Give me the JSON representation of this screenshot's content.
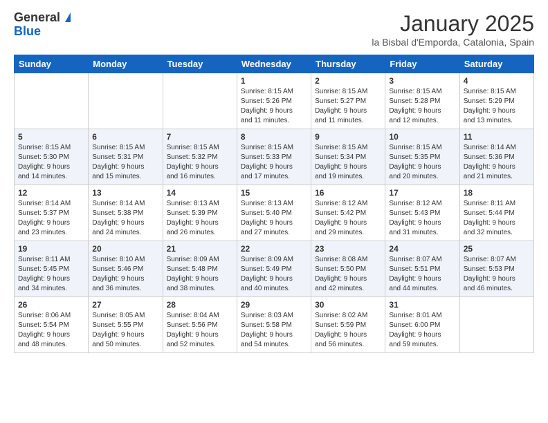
{
  "header": {
    "logo_general": "General",
    "logo_blue": "Blue",
    "month_title": "January 2025",
    "location": "la Bisbal d'Emporda, Catalonia, Spain"
  },
  "weekdays": [
    "Sunday",
    "Monday",
    "Tuesday",
    "Wednesday",
    "Thursday",
    "Friday",
    "Saturday"
  ],
  "weeks": [
    [
      {
        "day": "",
        "info": ""
      },
      {
        "day": "",
        "info": ""
      },
      {
        "day": "",
        "info": ""
      },
      {
        "day": "1",
        "info": "Sunrise: 8:15 AM\nSunset: 5:26 PM\nDaylight: 9 hours\nand 11 minutes."
      },
      {
        "day": "2",
        "info": "Sunrise: 8:15 AM\nSunset: 5:27 PM\nDaylight: 9 hours\nand 11 minutes."
      },
      {
        "day": "3",
        "info": "Sunrise: 8:15 AM\nSunset: 5:28 PM\nDaylight: 9 hours\nand 12 minutes."
      },
      {
        "day": "4",
        "info": "Sunrise: 8:15 AM\nSunset: 5:29 PM\nDaylight: 9 hours\nand 13 minutes."
      }
    ],
    [
      {
        "day": "5",
        "info": "Sunrise: 8:15 AM\nSunset: 5:30 PM\nDaylight: 9 hours\nand 14 minutes."
      },
      {
        "day": "6",
        "info": "Sunrise: 8:15 AM\nSunset: 5:31 PM\nDaylight: 9 hours\nand 15 minutes."
      },
      {
        "day": "7",
        "info": "Sunrise: 8:15 AM\nSunset: 5:32 PM\nDaylight: 9 hours\nand 16 minutes."
      },
      {
        "day": "8",
        "info": "Sunrise: 8:15 AM\nSunset: 5:33 PM\nDaylight: 9 hours\nand 17 minutes."
      },
      {
        "day": "9",
        "info": "Sunrise: 8:15 AM\nSunset: 5:34 PM\nDaylight: 9 hours\nand 19 minutes."
      },
      {
        "day": "10",
        "info": "Sunrise: 8:15 AM\nSunset: 5:35 PM\nDaylight: 9 hours\nand 20 minutes."
      },
      {
        "day": "11",
        "info": "Sunrise: 8:14 AM\nSunset: 5:36 PM\nDaylight: 9 hours\nand 21 minutes."
      }
    ],
    [
      {
        "day": "12",
        "info": "Sunrise: 8:14 AM\nSunset: 5:37 PM\nDaylight: 9 hours\nand 23 minutes."
      },
      {
        "day": "13",
        "info": "Sunrise: 8:14 AM\nSunset: 5:38 PM\nDaylight: 9 hours\nand 24 minutes."
      },
      {
        "day": "14",
        "info": "Sunrise: 8:13 AM\nSunset: 5:39 PM\nDaylight: 9 hours\nand 26 minutes."
      },
      {
        "day": "15",
        "info": "Sunrise: 8:13 AM\nSunset: 5:40 PM\nDaylight: 9 hours\nand 27 minutes."
      },
      {
        "day": "16",
        "info": "Sunrise: 8:12 AM\nSunset: 5:42 PM\nDaylight: 9 hours\nand 29 minutes."
      },
      {
        "day": "17",
        "info": "Sunrise: 8:12 AM\nSunset: 5:43 PM\nDaylight: 9 hours\nand 31 minutes."
      },
      {
        "day": "18",
        "info": "Sunrise: 8:11 AM\nSunset: 5:44 PM\nDaylight: 9 hours\nand 32 minutes."
      }
    ],
    [
      {
        "day": "19",
        "info": "Sunrise: 8:11 AM\nSunset: 5:45 PM\nDaylight: 9 hours\nand 34 minutes."
      },
      {
        "day": "20",
        "info": "Sunrise: 8:10 AM\nSunset: 5:46 PM\nDaylight: 9 hours\nand 36 minutes."
      },
      {
        "day": "21",
        "info": "Sunrise: 8:09 AM\nSunset: 5:48 PM\nDaylight: 9 hours\nand 38 minutes."
      },
      {
        "day": "22",
        "info": "Sunrise: 8:09 AM\nSunset: 5:49 PM\nDaylight: 9 hours\nand 40 minutes."
      },
      {
        "day": "23",
        "info": "Sunrise: 8:08 AM\nSunset: 5:50 PM\nDaylight: 9 hours\nand 42 minutes."
      },
      {
        "day": "24",
        "info": "Sunrise: 8:07 AM\nSunset: 5:51 PM\nDaylight: 9 hours\nand 44 minutes."
      },
      {
        "day": "25",
        "info": "Sunrise: 8:07 AM\nSunset: 5:53 PM\nDaylight: 9 hours\nand 46 minutes."
      }
    ],
    [
      {
        "day": "26",
        "info": "Sunrise: 8:06 AM\nSunset: 5:54 PM\nDaylight: 9 hours\nand 48 minutes."
      },
      {
        "day": "27",
        "info": "Sunrise: 8:05 AM\nSunset: 5:55 PM\nDaylight: 9 hours\nand 50 minutes."
      },
      {
        "day": "28",
        "info": "Sunrise: 8:04 AM\nSunset: 5:56 PM\nDaylight: 9 hours\nand 52 minutes."
      },
      {
        "day": "29",
        "info": "Sunrise: 8:03 AM\nSunset: 5:58 PM\nDaylight: 9 hours\nand 54 minutes."
      },
      {
        "day": "30",
        "info": "Sunrise: 8:02 AM\nSunset: 5:59 PM\nDaylight: 9 hours\nand 56 minutes."
      },
      {
        "day": "31",
        "info": "Sunrise: 8:01 AM\nSunset: 6:00 PM\nDaylight: 9 hours\nand 59 minutes."
      },
      {
        "day": "",
        "info": ""
      }
    ]
  ]
}
